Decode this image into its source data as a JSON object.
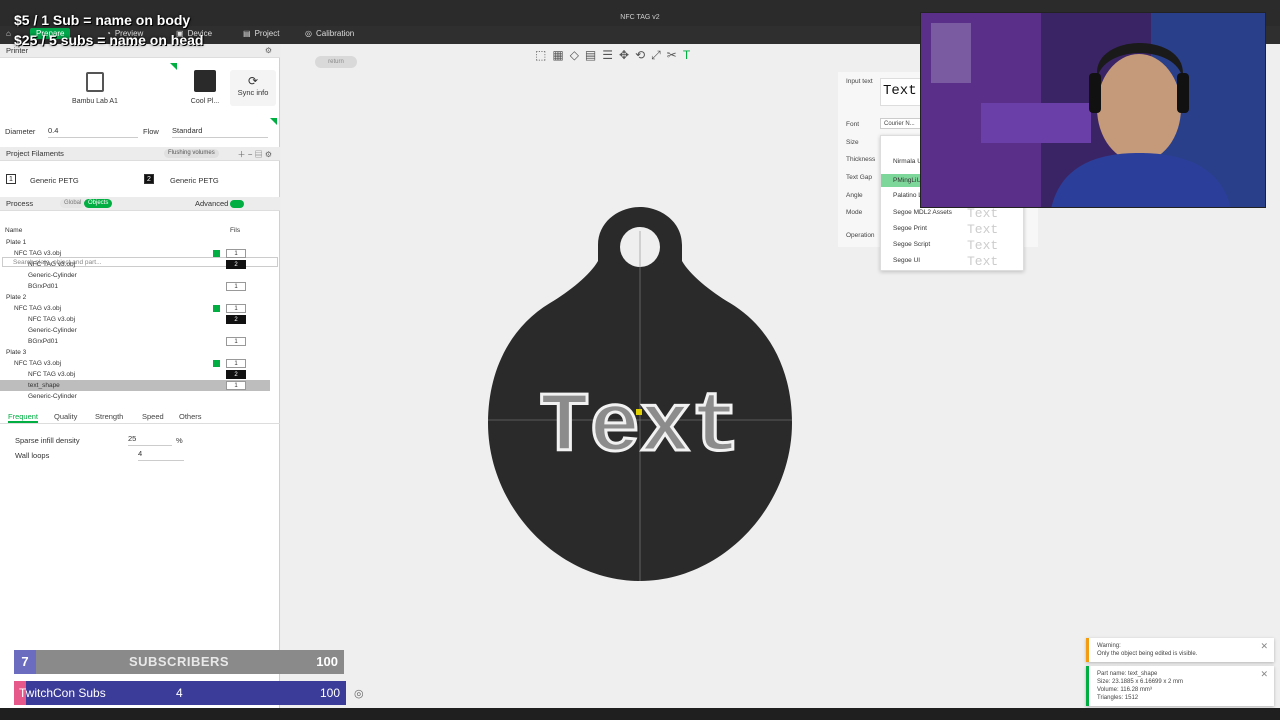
{
  "window": {
    "title": "NFC TAG v2"
  },
  "captions": {
    "line1": "$5 / 1 Sub = name on body",
    "line2": "$25 / 5 subs = name on head"
  },
  "tabs": [
    {
      "label": "Prepare"
    },
    {
      "label": "Preview"
    },
    {
      "label": "Device"
    },
    {
      "label": "Project"
    },
    {
      "label": "Calibration"
    }
  ],
  "printer": {
    "header": "Printer",
    "name": "Bambu Lab A1",
    "filament_short": "Cool Pl...",
    "sync_label": "Sync info",
    "diameter_label": "Diameter",
    "diameter_value": "0.4",
    "flow_label": "Flow",
    "flow_value": "Standard"
  },
  "filaments": {
    "header": "Project Filaments",
    "flushing": "Flushing volumes",
    "items": [
      {
        "num": "1",
        "name": "Generic PETG"
      },
      {
        "num": "2",
        "name": "Generic PETG"
      }
    ]
  },
  "process": {
    "header": "Process",
    "global": "Global",
    "objects": "Objects",
    "advanced": "Advanced",
    "search_placeholder": "Search plate, object and part..."
  },
  "tree": {
    "col_name": "Name",
    "col_fils": "Fils",
    "rows": [
      {
        "label": "Plate 1"
      },
      {
        "label": "NFC TAG v3.obj",
        "fil": "1"
      },
      {
        "label": "NFC TAG v3.obj",
        "fil": "2"
      },
      {
        "label": "Generic-Cylinder"
      },
      {
        "label": "BGrxPd01",
        "fil": "1"
      },
      {
        "label": "Plate 2"
      },
      {
        "label": "NFC TAG v3.obj",
        "fil": "1"
      },
      {
        "label": "NFC TAG v3.obj",
        "fil": "2"
      },
      {
        "label": "Generic-Cylinder"
      },
      {
        "label": "BGrxPd01",
        "fil": "1"
      },
      {
        "label": "Plate 3"
      },
      {
        "label": "NFC TAG v3.obj",
        "fil": "1"
      },
      {
        "label": "NFC TAG v3.obj",
        "fil": "2"
      },
      {
        "label": "text_shape",
        "fil": "1"
      },
      {
        "label": "Generic-Cylinder"
      }
    ]
  },
  "settings_tabs": [
    "Frequent",
    "Quality",
    "Strength",
    "Speed",
    "Others"
  ],
  "settings": {
    "infill_label": "Sparse infill density",
    "infill_value": "25",
    "infill_unit": "%",
    "walls_label": "Wall loops",
    "walls_value": "4"
  },
  "viewport": {
    "return_label": "return",
    "model_text": "Text"
  },
  "text_panel": {
    "input_label": "Input text",
    "input_value": "Text",
    "font_label": "Font",
    "font_value": "Courier N...",
    "size_label": "Size",
    "thickness_label": "Thickness",
    "gap_label": "Text Gap",
    "angle_label": "Angle",
    "mode_label": "Mode",
    "operation_label": "Operation",
    "fonts": [
      "Nirmala U...",
      "PMingLiU...",
      "Palatino L...",
      "Segoe MDL2 Assets",
      "Segoe Print",
      "Segoe Script",
      "Segoe UI"
    ],
    "preview_text": "Text"
  },
  "overlay": {
    "sub_count": "7",
    "sub_label": "SUBSCRIBERS",
    "sub_goal": "100",
    "twitch_label": "TwitchCon Subs",
    "twitch_count": "4",
    "twitch_goal": "100"
  },
  "notices": {
    "warning_title": "Warning:",
    "warning_body": "Only the object being edited is visible.",
    "part_name": "Part name: text_shape",
    "part_size": "Size: 23.1885 x 6.16699 x 2 mm",
    "part_volume": "Volume: 116.28 mm³",
    "part_triangles": "Triangles: 1512"
  },
  "colors": {
    "accent": "#00ae42",
    "panel": "#ffffff",
    "dark": "#2b2b2b"
  }
}
